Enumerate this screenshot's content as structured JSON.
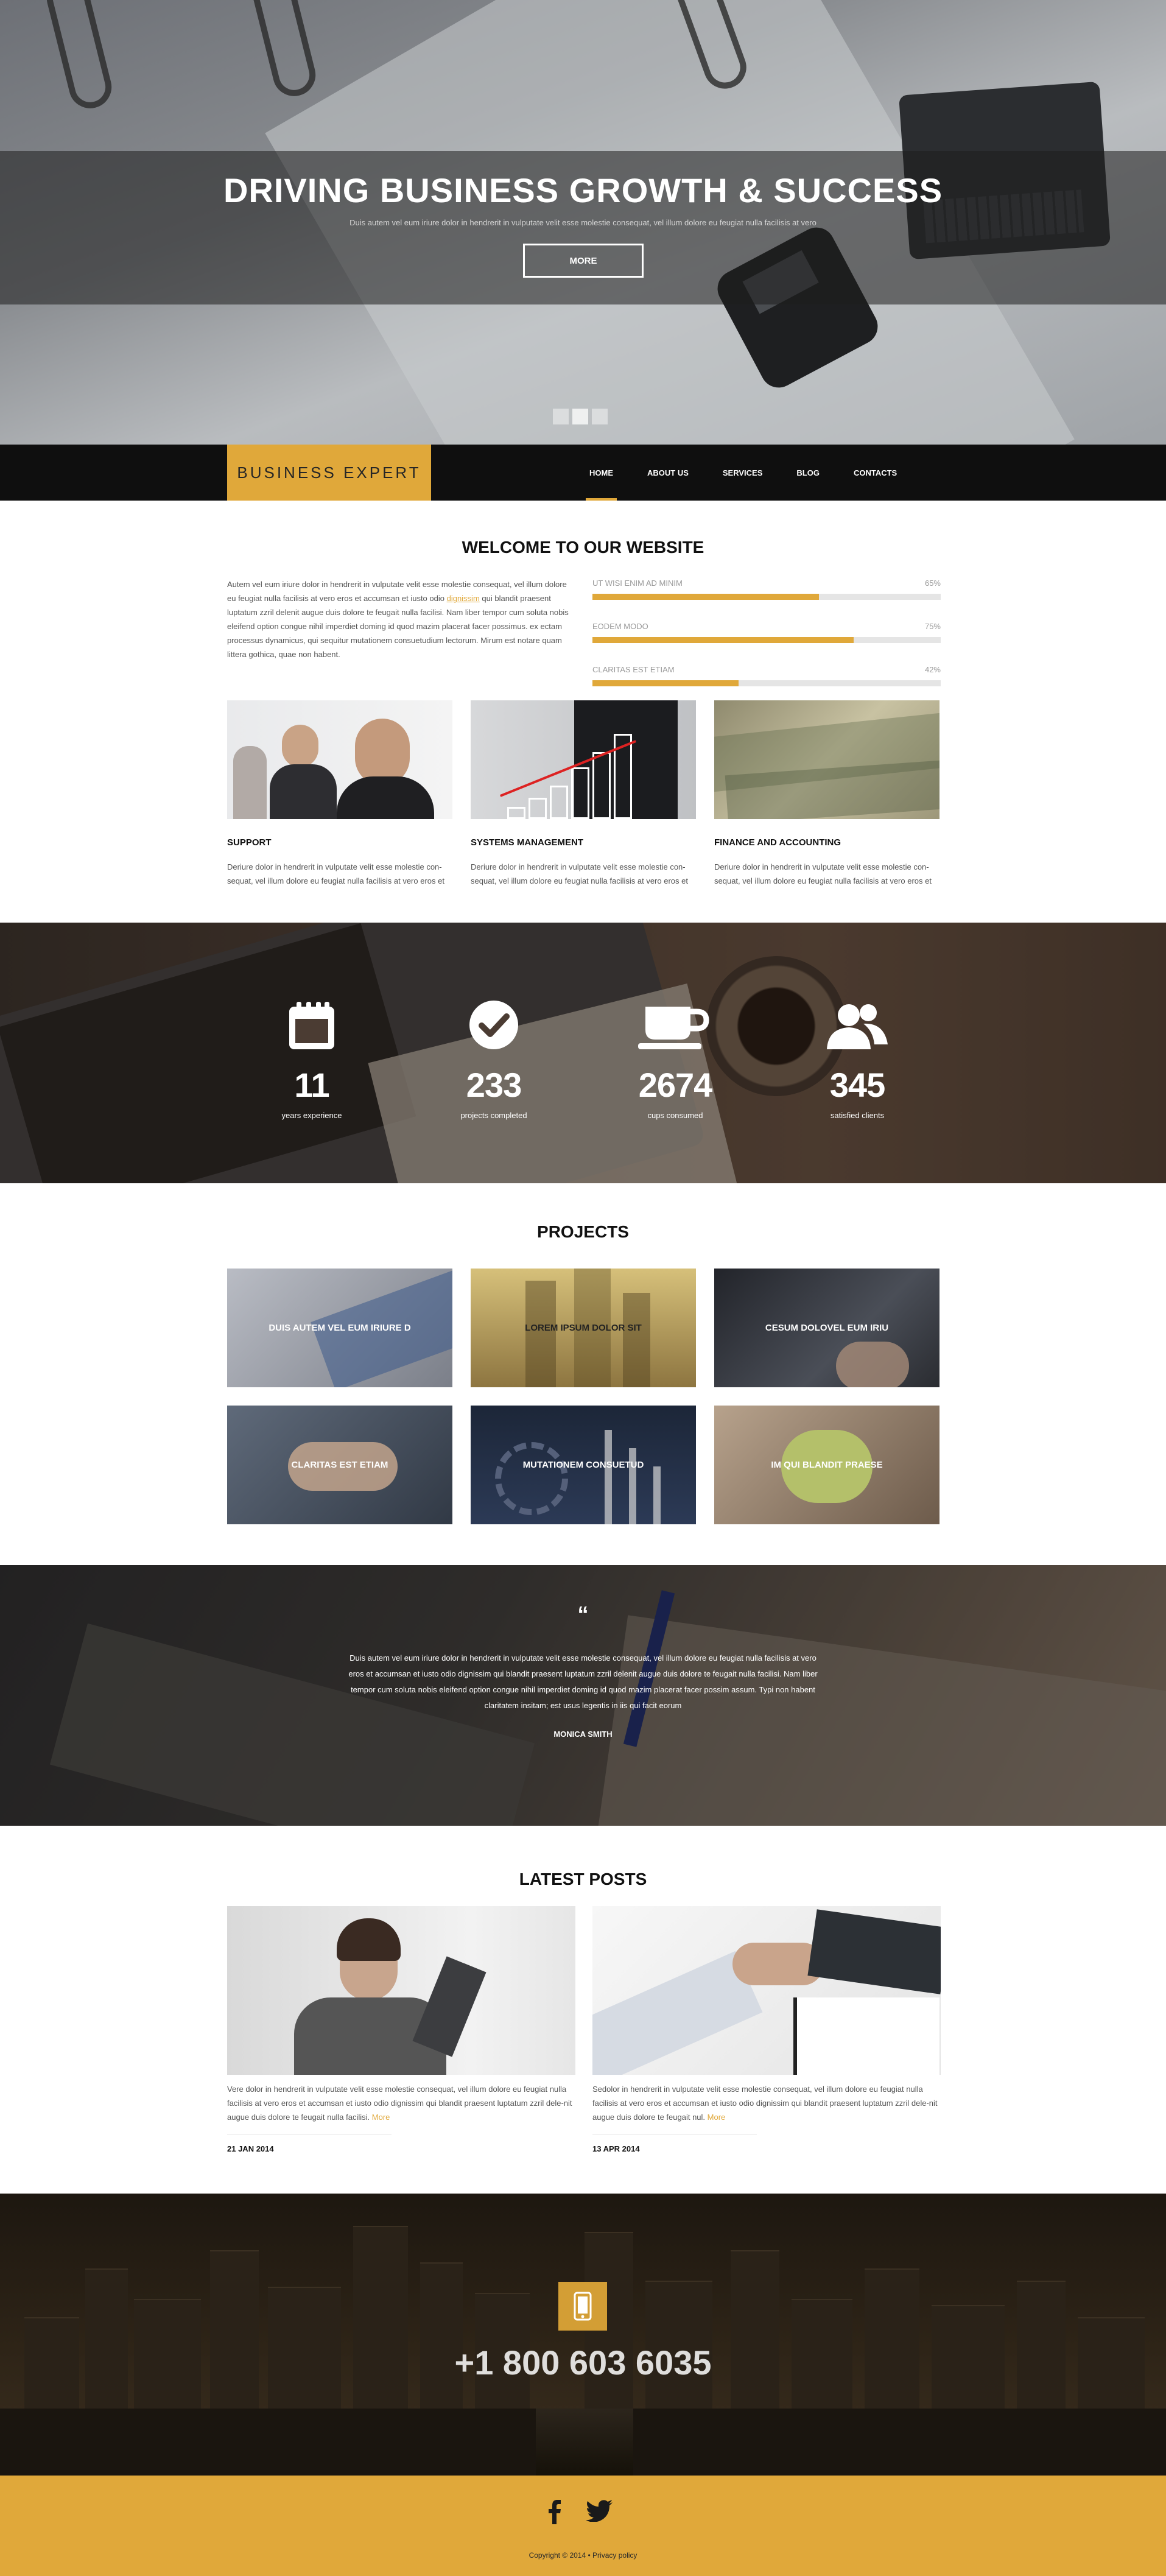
{
  "hero": {
    "title": "DRIVING BUSINESS GROWTH & SUCCESS",
    "subtitle": "Duis autem vel eum iriure dolor in hendrerit in vulputate velit esse molestie consequat, vel illum dolore eu feugiat nulla facilisis at vero",
    "button": "MORE",
    "slides": 3,
    "active_slide": 2
  },
  "nav": {
    "logo": "BUSINESS EXPERT",
    "items": [
      {
        "label": "HOME",
        "active": true
      },
      {
        "label": "ABOUT US",
        "active": false
      },
      {
        "label": "SERVICES",
        "active": false
      },
      {
        "label": "BLOG",
        "active": false
      },
      {
        "label": "CONTACTS",
        "active": false
      }
    ]
  },
  "welcome": {
    "title": "WELCOME TO OUR WEBSITE",
    "text_before": "Autem vel eum iriure dolor in hendrerit in vulputate velit esse molestie consequat, vel illum dolore eu feugiat nulla facilisis at vero eros et accumsan et iusto odio ",
    "text_link": "dignissim",
    "text_after": " qui blandit praesent luptatum zzril delenit augue duis dolore te feugait nulla facilisi. Nam liber tempor cum soluta nobis eleifend option congue nihil imperdiet doming id quod mazim placerat facer possimus. ex ectam processus dynamicus, qui sequitur mutationem consuetudium lectorum. Mirum est notare quam littera gothica, quae non habent.",
    "bars": [
      {
        "label": "UT WISI ENIM AD MINIM",
        "value": 65,
        "display": "65%"
      },
      {
        "label": "EODEM MODO",
        "value": 75,
        "display": "75%"
      },
      {
        "label": "CLARITAS EST ETIAM",
        "value": 42,
        "display": "42%"
      }
    ]
  },
  "services": [
    {
      "title": "SUPPORT",
      "text": "Deriure dolor in hendrerit in vulputate velit esse molestie con-sequat, vel illum dolore eu feugiat nulla facilisis at vero eros et"
    },
    {
      "title": "SYSTEMS MANAGEMENT",
      "text": "Deriure dolor in hendrerit in vulputate velit esse molestie con-sequat, vel illum dolore eu feugiat nulla facilisis at vero eros et"
    },
    {
      "title": "FINANCE AND ACCOUNTING",
      "text": "Deriure dolor in hendrerit in vulputate velit esse molestie con-sequat, vel illum dolore eu feugiat nulla facilisis at vero eros et"
    }
  ],
  "stats": [
    {
      "number": "11",
      "caption": "years experience",
      "icon": "calendar-icon"
    },
    {
      "number": "233",
      "caption": "projects completed",
      "icon": "checkmark-icon"
    },
    {
      "number": "2674",
      "caption": "cups consumed",
      "icon": "coffee-cup-icon"
    },
    {
      "number": "345",
      "caption": "satisfied clients",
      "icon": "users-icon"
    }
  ],
  "projects": {
    "title": "PROJECTS",
    "items": [
      {
        "label": "DUIS AUTEM VEL EUM IRIURE D"
      },
      {
        "label": "LOREM IPSUM DOLOR SIT"
      },
      {
        "label": "CESUM DOLOVEL EUM IRIU"
      },
      {
        "label": "CLARITAS EST ETIAM"
      },
      {
        "label": "MUTATIONEM CONSUETUD"
      },
      {
        "label": "IM QUI BLANDIT PRAESE"
      }
    ]
  },
  "testimonial": {
    "quote_mark": "“",
    "text": "Duis autem vel eum iriure dolor in hendrerit in vulputate velit esse molestie consequat, vel illum dolore eu feugiat nulla facilisis at vero eros et accumsan et iusto odio dignissim qui blandit praesent luptatum zzril delenit augue duis dolore te feugait nulla facilisi. Nam liber tempor cum soluta nobis eleifend option congue nihil imperdiet doming id quod mazim placerat facer possim assum. Typi non habent claritatem insitam; est usus legentis in iis qui facit eorum",
    "author": "MONICA SMITH"
  },
  "posts": {
    "title": "LATEST POSTS",
    "items": [
      {
        "text": "Vere dolor in hendrerit in vulputate velit esse molestie consequat, vel illum dolore eu feugiat nulla facilisis at vero eros et accumsan et iusto odio dignissim qui blandit praesent luptatum zzril dele-nit augue duis dolore te feugait nulla facilisi.",
        "more": "More",
        "date": "21 JAN 2014"
      },
      {
        "text": "Sedolor in hendrerit in vulputate velit esse molestie consequat, vel illum dolore eu feugiat nulla facilisis at vero eros et accumsan et iusto odio dignissim qui blandit praesent luptatum zzril dele-nit augue duis dolore te feugait nul.",
        "more": "More",
        "date": "13 APR 2014"
      }
    ]
  },
  "contact": {
    "phone": "+1 800 603 6035",
    "icon": "mobile-phone-icon"
  },
  "footer": {
    "social": [
      "facebook-icon",
      "twitter-icon"
    ],
    "copyright": "Copyright © 2014 •",
    "privacy": "Privacy policy"
  },
  "colors": {
    "accent": "#e0a83a",
    "dark": "#0f0f0f",
    "text": "#555555"
  }
}
